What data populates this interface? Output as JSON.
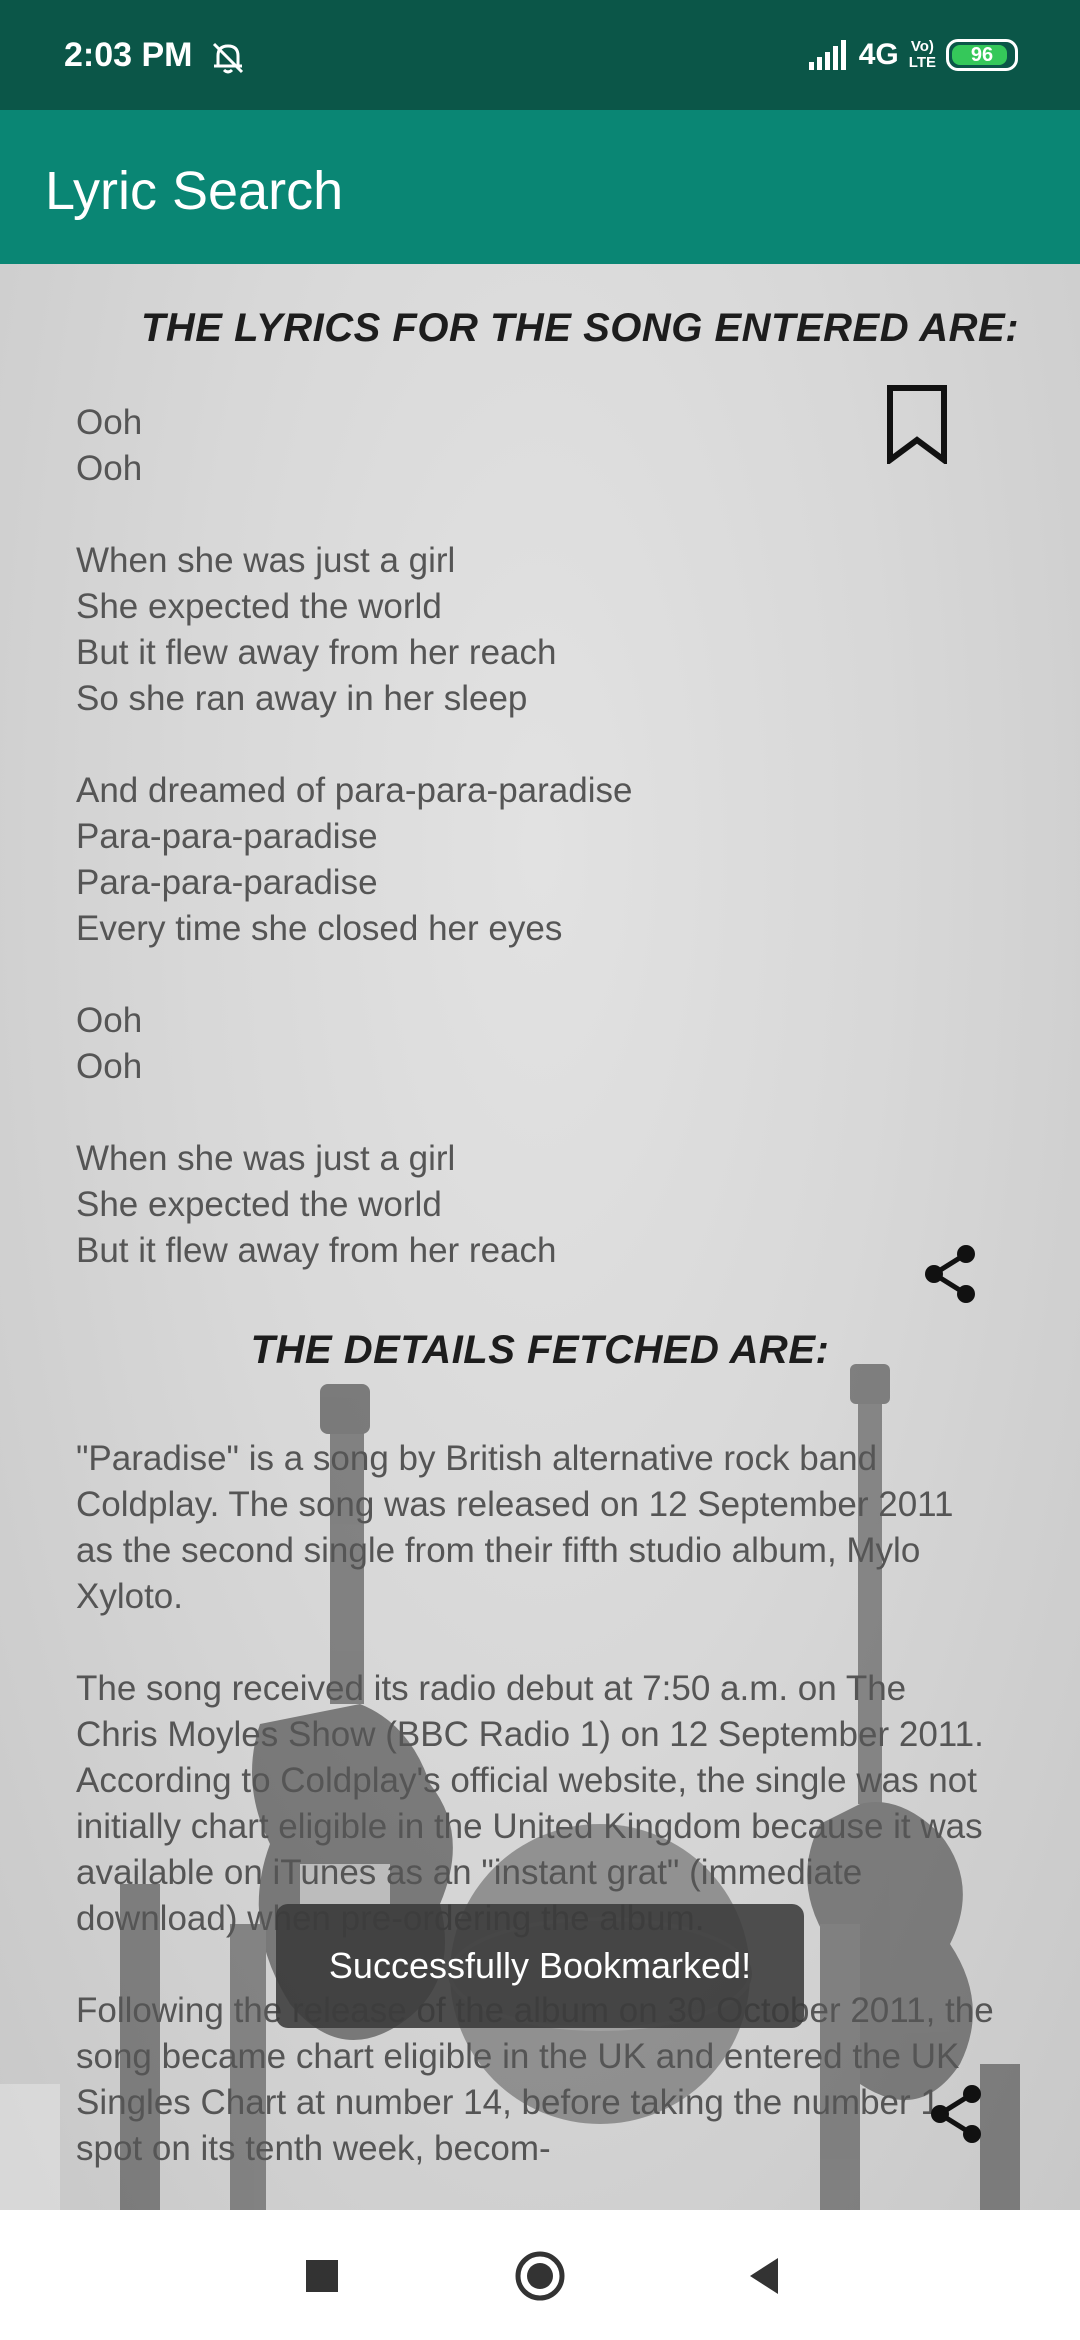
{
  "status_bar": {
    "time": "2:03 PM",
    "network": "4G",
    "volte_top": "Vo)",
    "volte_bottom": "LTE",
    "battery": "96"
  },
  "app_bar": {
    "title": "Lyric Search"
  },
  "lyrics": {
    "heading": "THE LYRICS FOR THE SONG ENTERED ARE:",
    "text": "Ooh\nOoh\n\nWhen she was just a girl\nShe expected the world\nBut it flew away from her reach\nSo she ran away in her sleep\n\nAnd dreamed of para-para-paradise\nPara-para-paradise\nPara-para-paradise\nEvery time she closed her eyes\n\nOoh\nOoh\n\nWhen she was just a girl\nShe expected the world\nBut it flew away from her reach"
  },
  "details": {
    "heading": "THE DETAILS FETCHED ARE:",
    "text": "\"Paradise\" is a song by British alternative rock band Coldplay. The song was released on 12 September 2011 as the second single from their fifth studio album, Mylo Xyloto.\n\nThe song received its radio debut at 7:50 a.m. on The Chris Moyles Show (BBC Radio 1) on 12 September 2011. According to Coldplay's official website, the single was not initially chart eligible in the United Kingdom because it was available on iTunes as an \"instant grat\" (immediate download) when pre-ordering the album.\n\nFollowing the release of the album on 30 October 2011, the song became chart eligible in the UK and entered the UK Singles Chart at number 14, before taking the number 1 spot on its tenth week, becom-"
  },
  "toast": {
    "message": "Successfully Bookmarked!"
  },
  "icons": {
    "bookmark": "bookmark-icon",
    "share": "share-icon",
    "dnd": "bell-off-icon",
    "signal": "signal-icon",
    "battery": "battery-icon"
  },
  "colors": {
    "status_bar": "#0b5648",
    "app_bar": "#0a8674",
    "battery_fill": "#35c85a"
  }
}
